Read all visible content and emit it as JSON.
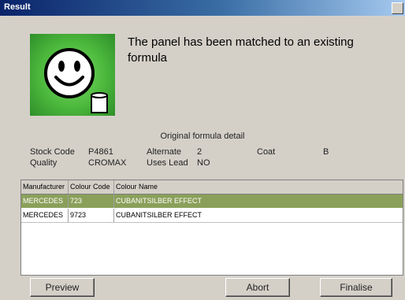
{
  "window": {
    "title": "Result"
  },
  "message": "The panel has been matched to an existing formula",
  "detail": {
    "section_title": "Original formula detail",
    "stock_code_label": "Stock Code",
    "stock_code_value": "P4861",
    "alternate_label": "Alternate",
    "alternate_value": "2",
    "coat_label": "Coat",
    "coat_value": "B",
    "quality_label": "Quality",
    "quality_value": "CROMAX",
    "uses_lead_label": "Uses Lead",
    "uses_lead_value": "NO"
  },
  "table": {
    "headers": [
      "Manufacturer",
      "Colour Code",
      "Colour Name"
    ],
    "rows": [
      [
        "MERCEDES",
        "723",
        "CUBANITSILBER EFFECT"
      ],
      [
        "MERCEDES",
        "9723",
        "CUBANITSILBER EFFECT"
      ]
    ],
    "selected_row": 0
  },
  "buttons": {
    "preview": "Preview",
    "abort": "Abort",
    "finalise": "Finalise"
  },
  "icon": {
    "name": "smiley-paint-can-icon",
    "bg_color": "#4cb83c"
  }
}
